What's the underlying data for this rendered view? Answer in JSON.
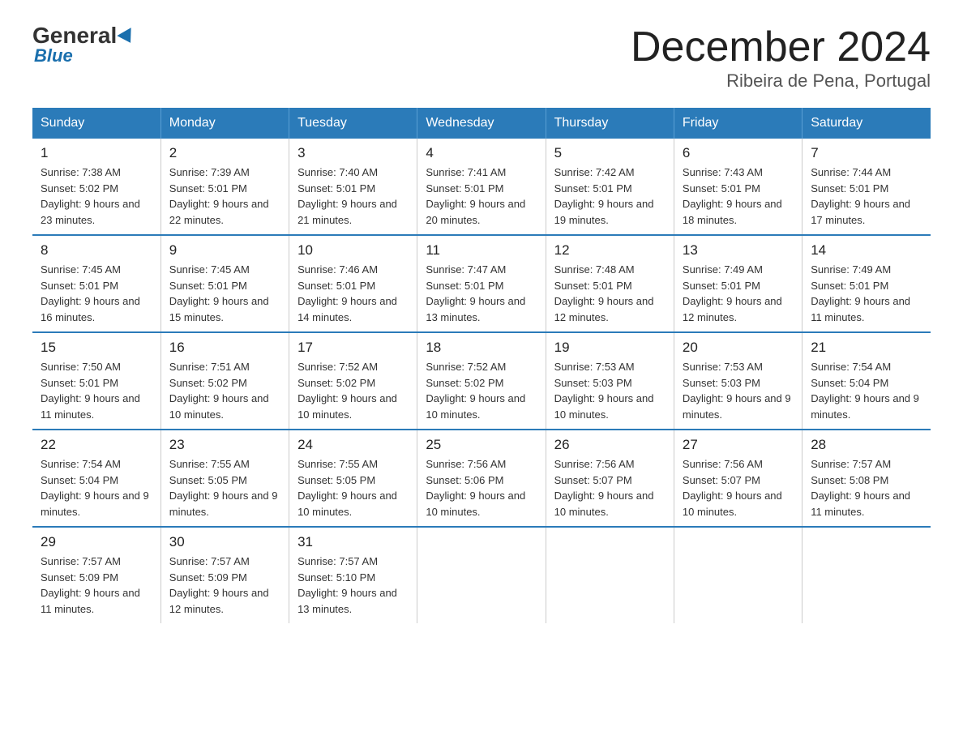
{
  "logo": {
    "general": "General",
    "blue": "Blue"
  },
  "header": {
    "month_title": "December 2024",
    "location": "Ribeira de Pena, Portugal"
  },
  "days_of_week": [
    "Sunday",
    "Monday",
    "Tuesday",
    "Wednesday",
    "Thursday",
    "Friday",
    "Saturday"
  ],
  "weeks": [
    [
      {
        "day": "1",
        "sunrise": "7:38 AM",
        "sunset": "5:02 PM",
        "daylight": "9 hours and 23 minutes."
      },
      {
        "day": "2",
        "sunrise": "7:39 AM",
        "sunset": "5:01 PM",
        "daylight": "9 hours and 22 minutes."
      },
      {
        "day": "3",
        "sunrise": "7:40 AM",
        "sunset": "5:01 PM",
        "daylight": "9 hours and 21 minutes."
      },
      {
        "day": "4",
        "sunrise": "7:41 AM",
        "sunset": "5:01 PM",
        "daylight": "9 hours and 20 minutes."
      },
      {
        "day": "5",
        "sunrise": "7:42 AM",
        "sunset": "5:01 PM",
        "daylight": "9 hours and 19 minutes."
      },
      {
        "day": "6",
        "sunrise": "7:43 AM",
        "sunset": "5:01 PM",
        "daylight": "9 hours and 18 minutes."
      },
      {
        "day": "7",
        "sunrise": "7:44 AM",
        "sunset": "5:01 PM",
        "daylight": "9 hours and 17 minutes."
      }
    ],
    [
      {
        "day": "8",
        "sunrise": "7:45 AM",
        "sunset": "5:01 PM",
        "daylight": "9 hours and 16 minutes."
      },
      {
        "day": "9",
        "sunrise": "7:45 AM",
        "sunset": "5:01 PM",
        "daylight": "9 hours and 15 minutes."
      },
      {
        "day": "10",
        "sunrise": "7:46 AM",
        "sunset": "5:01 PM",
        "daylight": "9 hours and 14 minutes."
      },
      {
        "day": "11",
        "sunrise": "7:47 AM",
        "sunset": "5:01 PM",
        "daylight": "9 hours and 13 minutes."
      },
      {
        "day": "12",
        "sunrise": "7:48 AM",
        "sunset": "5:01 PM",
        "daylight": "9 hours and 12 minutes."
      },
      {
        "day": "13",
        "sunrise": "7:49 AM",
        "sunset": "5:01 PM",
        "daylight": "9 hours and 12 minutes."
      },
      {
        "day": "14",
        "sunrise": "7:49 AM",
        "sunset": "5:01 PM",
        "daylight": "9 hours and 11 minutes."
      }
    ],
    [
      {
        "day": "15",
        "sunrise": "7:50 AM",
        "sunset": "5:01 PM",
        "daylight": "9 hours and 11 minutes."
      },
      {
        "day": "16",
        "sunrise": "7:51 AM",
        "sunset": "5:02 PM",
        "daylight": "9 hours and 10 minutes."
      },
      {
        "day": "17",
        "sunrise": "7:52 AM",
        "sunset": "5:02 PM",
        "daylight": "9 hours and 10 minutes."
      },
      {
        "day": "18",
        "sunrise": "7:52 AM",
        "sunset": "5:02 PM",
        "daylight": "9 hours and 10 minutes."
      },
      {
        "day": "19",
        "sunrise": "7:53 AM",
        "sunset": "5:03 PM",
        "daylight": "9 hours and 10 minutes."
      },
      {
        "day": "20",
        "sunrise": "7:53 AM",
        "sunset": "5:03 PM",
        "daylight": "9 hours and 9 minutes."
      },
      {
        "day": "21",
        "sunrise": "7:54 AM",
        "sunset": "5:04 PM",
        "daylight": "9 hours and 9 minutes."
      }
    ],
    [
      {
        "day": "22",
        "sunrise": "7:54 AM",
        "sunset": "5:04 PM",
        "daylight": "9 hours and 9 minutes."
      },
      {
        "day": "23",
        "sunrise": "7:55 AM",
        "sunset": "5:05 PM",
        "daylight": "9 hours and 9 minutes."
      },
      {
        "day": "24",
        "sunrise": "7:55 AM",
        "sunset": "5:05 PM",
        "daylight": "9 hours and 10 minutes."
      },
      {
        "day": "25",
        "sunrise": "7:56 AM",
        "sunset": "5:06 PM",
        "daylight": "9 hours and 10 minutes."
      },
      {
        "day": "26",
        "sunrise": "7:56 AM",
        "sunset": "5:07 PM",
        "daylight": "9 hours and 10 minutes."
      },
      {
        "day": "27",
        "sunrise": "7:56 AM",
        "sunset": "5:07 PM",
        "daylight": "9 hours and 10 minutes."
      },
      {
        "day": "28",
        "sunrise": "7:57 AM",
        "sunset": "5:08 PM",
        "daylight": "9 hours and 11 minutes."
      }
    ],
    [
      {
        "day": "29",
        "sunrise": "7:57 AM",
        "sunset": "5:09 PM",
        "daylight": "9 hours and 11 minutes."
      },
      {
        "day": "30",
        "sunrise": "7:57 AM",
        "sunset": "5:09 PM",
        "daylight": "9 hours and 12 minutes."
      },
      {
        "day": "31",
        "sunrise": "7:57 AM",
        "sunset": "5:10 PM",
        "daylight": "9 hours and 13 minutes."
      },
      null,
      null,
      null,
      null
    ]
  ]
}
